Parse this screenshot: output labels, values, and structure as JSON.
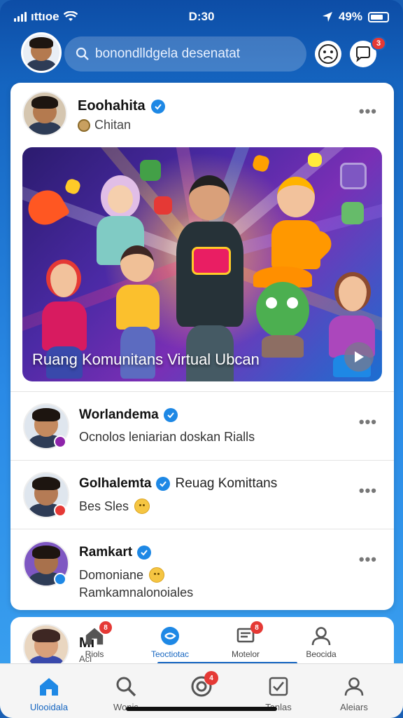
{
  "status_bar": {
    "carrier": "ıttıoe",
    "time": "D:30",
    "battery_text": "49%"
  },
  "header": {
    "search_placeholder": "bonondlldgela desenatat",
    "messages_badge": "3"
  },
  "post": {
    "author": "Eoohahita",
    "subtitle": "Chitan",
    "more": "•••",
    "image_title": "Ruang Komunitans Virtual Ubcan"
  },
  "list": [
    {
      "name": "Worlandema",
      "extra": "",
      "sub": "Ocnolos leniarian doskan Rialls",
      "sub2": "",
      "badge_color": "#8e24aa",
      "emoji": false
    },
    {
      "name": "Golhalemta",
      "extra": "Reuag Komittans",
      "sub": "Bes Sles",
      "sub2": "",
      "badge_color": "#e53935",
      "emoji": true
    },
    {
      "name": "Ramkart",
      "extra": "",
      "sub": "Domoniane",
      "sub2": "Ramkamnalonoiales",
      "badge_color": "#1e88e5",
      "emoji": true
    }
  ],
  "panel2": {
    "name": "Mi",
    "sub": "Aci",
    "tabs": [
      {
        "label": "Riols",
        "badge": "8",
        "icon": "home-icon"
      },
      {
        "label": "Teoctiotac",
        "badge": "",
        "icon": "community-icon"
      },
      {
        "label": "Motelor",
        "badge": "8",
        "icon": "message-icon"
      },
      {
        "label": "Beocida",
        "badge": "",
        "icon": "profile-icon"
      }
    ]
  },
  "bottom_nav": [
    {
      "label": "Ulooidala",
      "icon": "home-icon",
      "badge": ""
    },
    {
      "label": "Wonis",
      "icon": "search-icon",
      "badge": ""
    },
    {
      "label": "",
      "icon": "activity-icon",
      "badge": "4"
    },
    {
      "label": "Tanlas",
      "icon": "checklist-icon",
      "badge": ""
    },
    {
      "label": "Aleiars",
      "icon": "profile-icon",
      "badge": ""
    }
  ],
  "colors": {
    "brand": "#1565c0",
    "badge": "#e53935",
    "verified": "#1e88e5"
  }
}
